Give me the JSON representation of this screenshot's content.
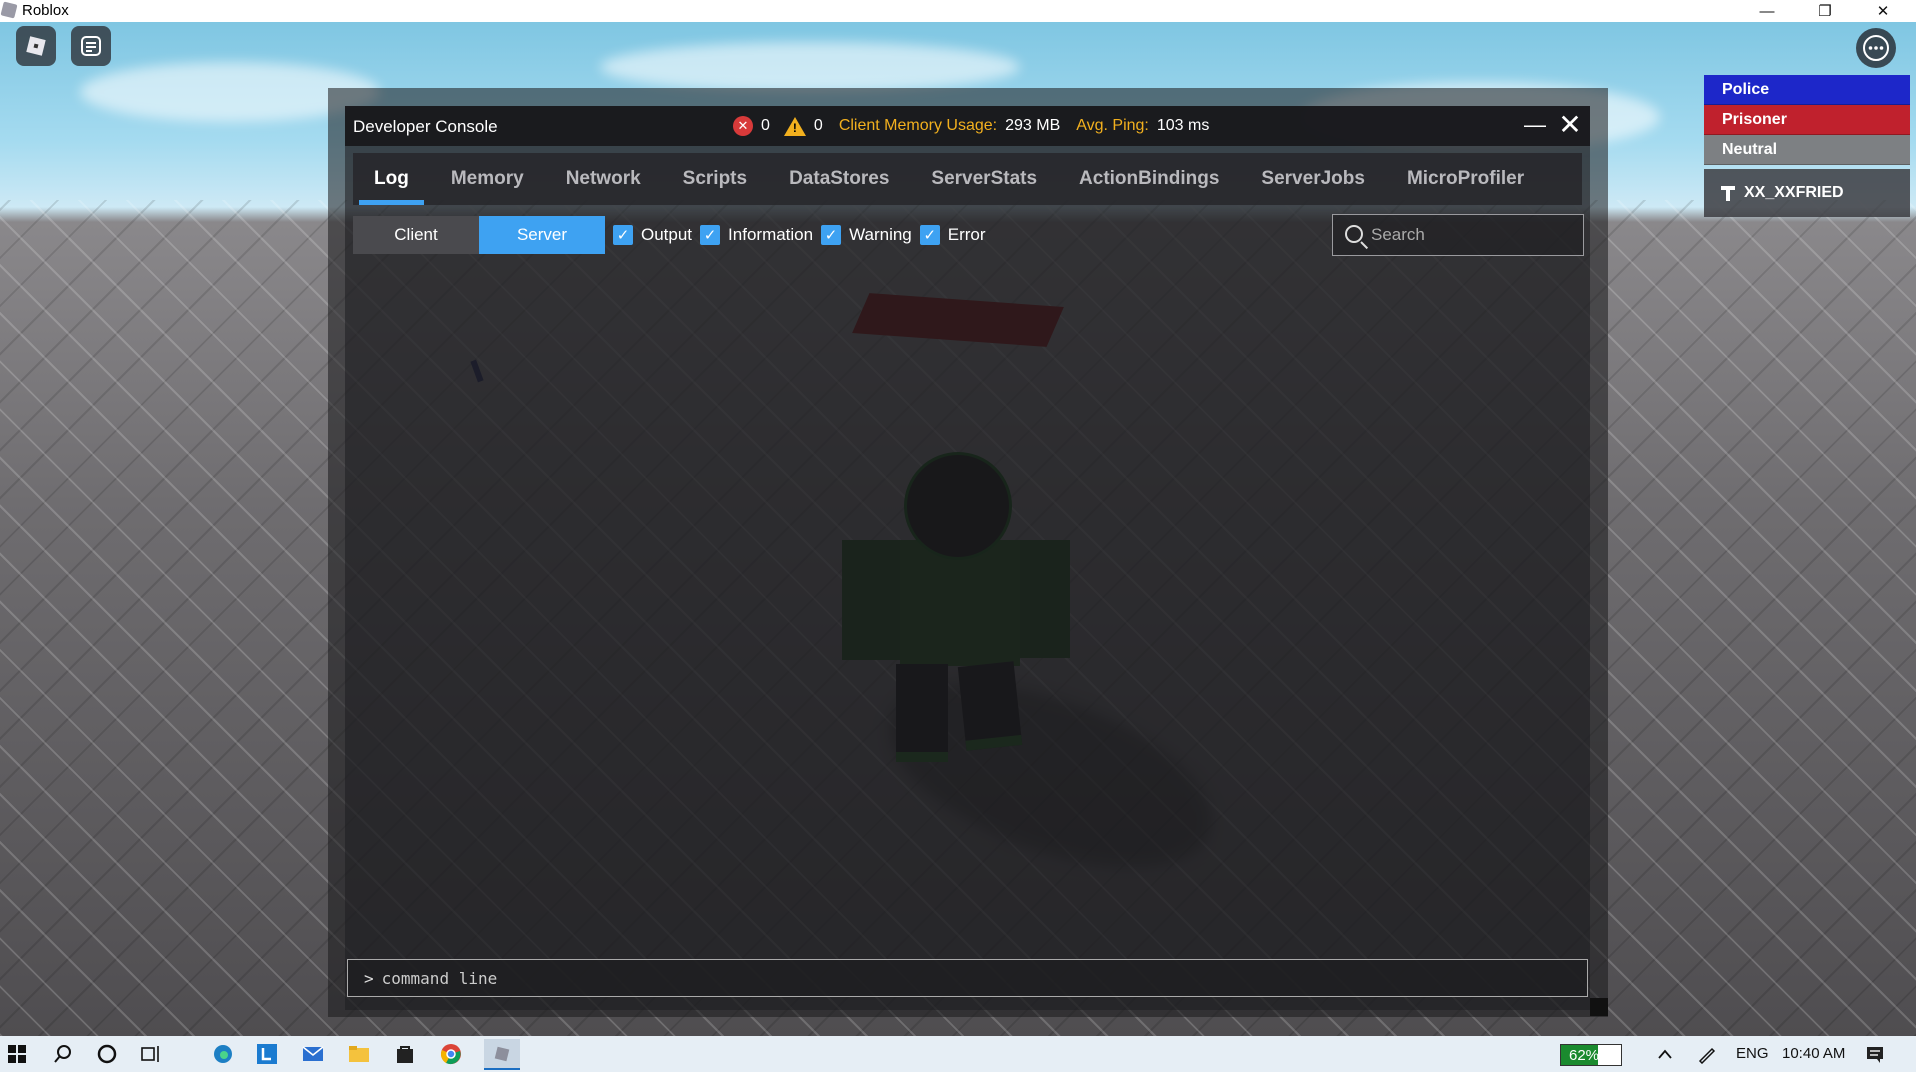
{
  "window": {
    "title": "Roblox",
    "controls": {
      "minimize": "—",
      "restore": "❐",
      "close": "✕"
    }
  },
  "playerlist": {
    "teams": [
      {
        "label": "Police",
        "color": "#1d27c9"
      },
      {
        "label": "Prisoner",
        "color": "#c0212d"
      },
      {
        "label": "Neutral",
        "color": "#7d8083"
      }
    ],
    "player_name": "XX_XXFRIED"
  },
  "console": {
    "title": "Developer Console",
    "errors": "0",
    "warnings": "0",
    "memory_label": "Client Memory Usage:",
    "memory_value": "293 MB",
    "ping_label": "Avg. Ping:",
    "ping_value": "103 ms",
    "tabs": [
      "Log",
      "Memory",
      "Network",
      "Scripts",
      "DataStores",
      "ServerStats",
      "ActionBindings",
      "ServerJobs",
      "MicroProfiler"
    ],
    "active_tab": "Log",
    "segments": [
      "Client",
      "Server"
    ],
    "active_segment": "Server",
    "filters": [
      "Output",
      "Information",
      "Warning",
      "Error"
    ],
    "search_placeholder": "Search",
    "prompt": ">",
    "command_placeholder": "command line"
  },
  "taskbar": {
    "battery": "62%",
    "battery_level": 0.62,
    "language": "ENG",
    "time": "10:40 AM"
  },
  "colors": {
    "accent": "#3ea2f2",
    "warning": "#f2b01e",
    "error": "#d83a3a"
  }
}
